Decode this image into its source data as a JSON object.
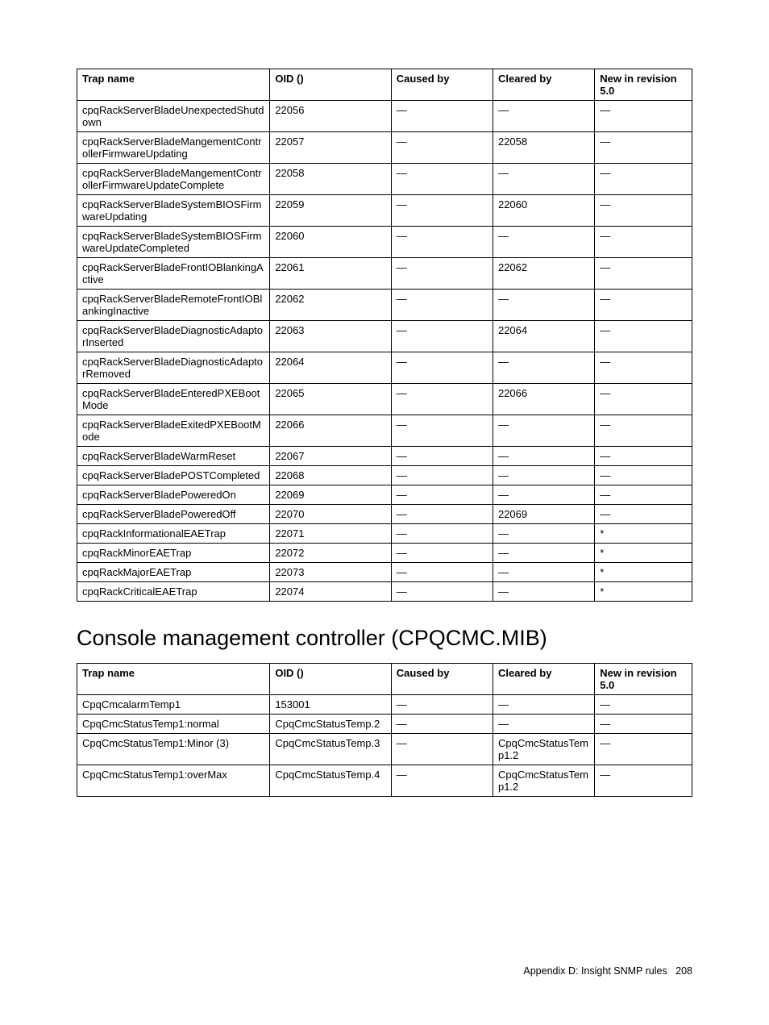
{
  "tables": {
    "table1": {
      "headers": {
        "trap": "Trap name",
        "oid": "OID ()",
        "caused": "Caused by",
        "cleared": "Cleared by",
        "new": "New in revision 5.0"
      },
      "rows": [
        {
          "trap": "cpqRackServerBladeUnexpectedShutdown",
          "oid": "22056",
          "caused": "—",
          "cleared": "—",
          "new": "—"
        },
        {
          "trap": "cpqRackServerBladeMangementControllerFirmwareUpdating",
          "oid": "22057",
          "caused": "—",
          "cleared": "22058",
          "new": "—"
        },
        {
          "trap": "cpqRackServerBladeMangementControllerFirmwareUpdateComplete",
          "oid": "22058",
          "caused": "—",
          "cleared": "—",
          "new": "—"
        },
        {
          "trap": "cpqRackServerBladeSystemBIOSFirmwareUpdating",
          "oid": "22059",
          "caused": "—",
          "cleared": "22060",
          "new": "—"
        },
        {
          "trap": "cpqRackServerBladeSystemBIOSFirmwareUpdateCompleted",
          "oid": "22060",
          "caused": "—",
          "cleared": "—",
          "new": "—"
        },
        {
          "trap": "cpqRackServerBladeFrontIOBlankingActive",
          "oid": "22061",
          "caused": "—",
          "cleared": "22062",
          "new": "—"
        },
        {
          "trap": "cpqRackServerBladeRemoteFrontIOBlankingInactive",
          "oid": "22062",
          "caused": "—",
          "cleared": "—",
          "new": "—"
        },
        {
          "trap": "cpqRackServerBladeDiagnosticAdaptorInserted",
          "oid": "22063",
          "caused": "—",
          "cleared": "22064",
          "new": "—"
        },
        {
          "trap": "cpqRackServerBladeDiagnosticAdaptorRemoved",
          "oid": "22064",
          "caused": "—",
          "cleared": "—",
          "new": "—"
        },
        {
          "trap": "cpqRackServerBladeEnteredPXEBootMode",
          "oid": "22065",
          "caused": "—",
          "cleared": "22066",
          "new": "—"
        },
        {
          "trap": "cpqRackServerBladeExitedPXEBootMode",
          "oid": "22066",
          "caused": "—",
          "cleared": "—",
          "new": "—"
        },
        {
          "trap": "cpqRackServerBladeWarmReset",
          "oid": "22067",
          "caused": "—",
          "cleared": "—",
          "new": "—"
        },
        {
          "trap": "cpqRackServerBladePOSTCompleted",
          "oid": "22068",
          "caused": "—",
          "cleared": "—",
          "new": "—"
        },
        {
          "trap": "cpqRackServerBladePoweredOn",
          "oid": "22069",
          "caused": "—",
          "cleared": "—",
          "new": "—"
        },
        {
          "trap": "cpqRackServerBladePoweredOff",
          "oid": "22070",
          "caused": "—",
          "cleared": "22069",
          "new": "—"
        },
        {
          "trap": "cpqRackInformationalEAETrap",
          "oid": "22071",
          "caused": "—",
          "cleared": "—",
          "new": "*"
        },
        {
          "trap": "cpqRackMinorEAETrap",
          "oid": "22072",
          "caused": "—",
          "cleared": "—",
          "new": "*"
        },
        {
          "trap": "cpqRackMajorEAETrap",
          "oid": "22073",
          "caused": "—",
          "cleared": "—",
          "new": "*"
        },
        {
          "trap": "cpqRackCriticalEAETrap",
          "oid": "22074",
          "caused": "—",
          "cleared": "—",
          "new": "*"
        }
      ]
    },
    "section2_title": "Console management controller (CPQCMC.MIB)",
    "table2": {
      "headers": {
        "trap": "Trap name",
        "oid": "OID ()",
        "caused": "Caused by",
        "cleared": "Cleared by",
        "new": "New in revision 5.0"
      },
      "rows": [
        {
          "trap": "CpqCmcalarmTemp1",
          "oid": "153001",
          "caused": "—",
          "cleared": "—",
          "new": "—"
        },
        {
          "trap": "CpqCmcStatusTemp1:normal",
          "oid": "CpqCmcStatusTemp.2",
          "caused": "—",
          "cleared": "—",
          "new": "—"
        },
        {
          "trap": "CpqCmcStatusTemp1:Minor (3)",
          "oid": "CpqCmcStatusTemp.3",
          "caused": "—",
          "cleared": "CpqCmcStatusTemp1.2",
          "new": "—"
        },
        {
          "trap": "CpqCmcStatusTemp1:overMax",
          "oid": "CpqCmcStatusTemp.4",
          "caused": "—",
          "cleared": "CpqCmcStatusTemp1.2",
          "new": "—"
        }
      ]
    }
  },
  "footer": {
    "text": "Appendix D: Insight SNMP rules",
    "page": "208"
  }
}
